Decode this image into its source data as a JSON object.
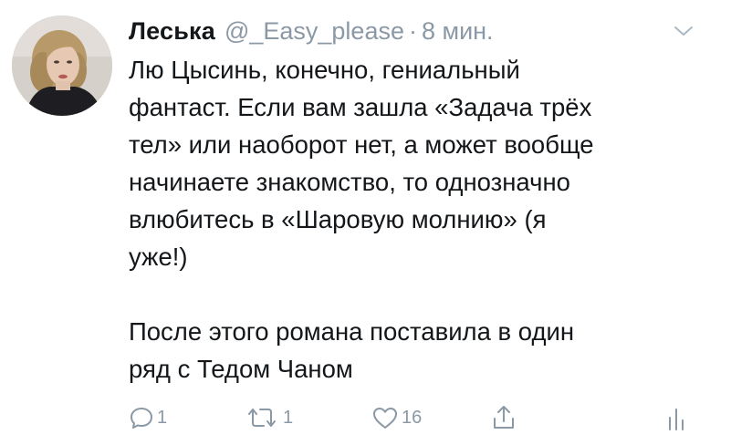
{
  "tweet": {
    "author_name": "Леська",
    "handle": "@_Easy_please",
    "separator": "·",
    "time": "8 мин.",
    "text": "Лю Цысинь, конечно, гениальный\nфантаст. Если вам зашла «Задача трёх\nтел» или наоборот нет, а может вообще\nначинаете знакомство, то однозначно\nвлюбитесь в «Шаровую молнию» (я\nуже!)\n\nПосле этого романа поставила в один\nряд с Тедом Чаном",
    "actions": {
      "reply_count": "1",
      "retweet_count": "1",
      "like_count": "16"
    }
  },
  "icons": {
    "menu": "chevron-down-icon",
    "reply": "reply-icon",
    "retweet": "retweet-icon",
    "like": "heart-icon",
    "share": "share-icon",
    "stats": "analytics-icon"
  },
  "colors": {
    "text": "#14171a",
    "secondary": "#8b98a5",
    "background": "#ffffff"
  }
}
